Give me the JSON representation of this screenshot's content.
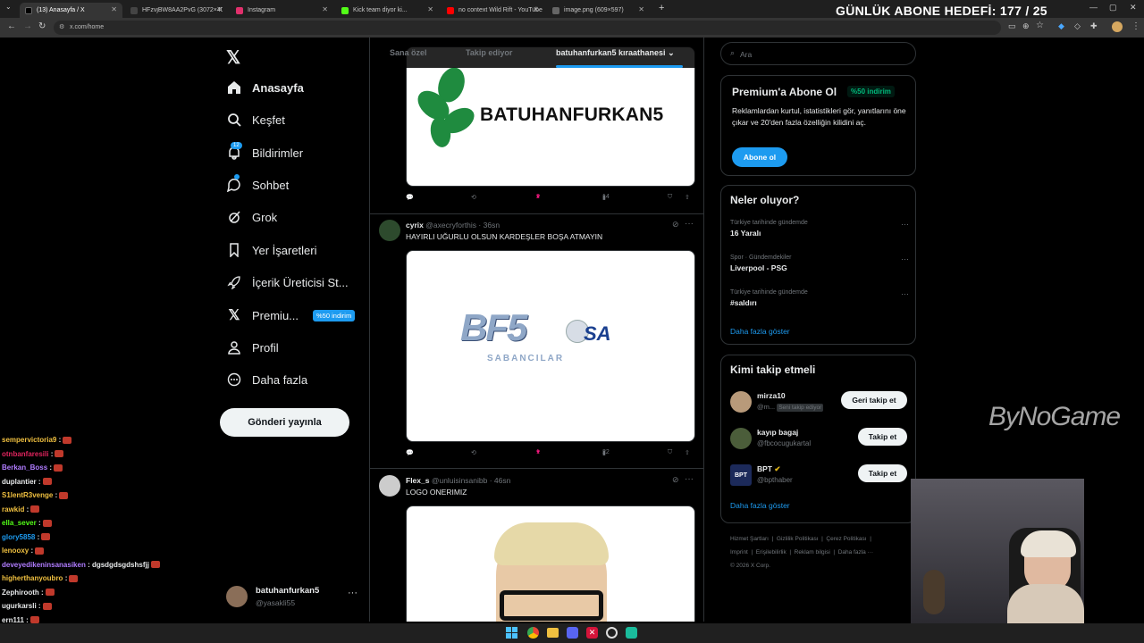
{
  "browser": {
    "tabs": [
      {
        "title": "(13) Anasayfa / X",
        "active": true,
        "fav_color": "#000000"
      },
      {
        "title": "HFzvjBW8AA2PvG (3072×4096)",
        "active": false,
        "fav_color": "#444444"
      },
      {
        "title": "Instagram",
        "active": false,
        "fav_color": "#e1306c"
      },
      {
        "title": "Kick team diyor ki...",
        "active": false,
        "fav_color": "#53fc18"
      },
      {
        "title": "no context Wild Rift - YouTube",
        "active": false,
        "fav_color": "#ff0000"
      },
      {
        "title": "image.png (609×597)",
        "active": false,
        "fav_color": "#666666"
      }
    ],
    "url": "x.com/home"
  },
  "overlay": {
    "goal_text": "GÜNLÜK ABONE HEDEFİ: 177 / 25",
    "watermark": "ByNoGame"
  },
  "nav": {
    "items": [
      {
        "label": "Anasayfa",
        "icon": "home-icon"
      },
      {
        "label": "Keşfet",
        "icon": "search-icon"
      },
      {
        "label": "Bildirimler",
        "icon": "bell-icon",
        "badge": "12"
      },
      {
        "label": "Sohbet",
        "icon": "chat-icon"
      },
      {
        "label": "Grok",
        "icon": "grok-icon"
      },
      {
        "label": "Yer İşaretleri",
        "icon": "bookmark-icon"
      },
      {
        "label": "İçerik Üreticisi St...",
        "icon": "rocket-icon"
      },
      {
        "label": "Premiu...",
        "icon": "x-icon",
        "pill": "%50 indirim"
      },
      {
        "label": "Profil",
        "icon": "person-icon"
      },
      {
        "label": "Daha fazla",
        "icon": "more-circle-icon"
      }
    ],
    "post_button": "Gönderi yayınla",
    "account": {
      "name": "batuhanfurkan5",
      "handle": "@yasakli55"
    }
  },
  "feed": {
    "tabs": [
      "Sana özel",
      "Takip ediyor",
      "batuhanfurkan5 kıraathanesi"
    ],
    "post0": {
      "image_text": "BATUHANFURKAN5",
      "likes": "2",
      "views": "14"
    },
    "post1": {
      "name": "cyrix",
      "handle": "@axecryforthis",
      "time": "· 36sn",
      "text": "HAYIRLI UĞURLU OLSUN KARDEŞLER BOŞA ATMAYIN",
      "logo_main": "BF5",
      "logo_sa": "SA",
      "logo_sub": "SABANCILAR",
      "likes": "1",
      "views": "22"
    },
    "post2": {
      "name": "Flex_s",
      "handle": "@unluisinsanibb",
      "time": "· 46sn",
      "text": "LOGO ONERIMIZ"
    }
  },
  "right": {
    "search_placeholder": "Ara",
    "premium": {
      "title": "Premium'a Abone Ol",
      "pill": "%50 indirim",
      "desc": "Reklamlardan kurtul, istatistikleri gör, yanıtlarını öne çıkar ve 20'den fazla özelliğin kilidini aç.",
      "button": "Abone ol"
    },
    "trends": {
      "title": "Neler oluyor?",
      "items": [
        {
          "context": "Türkiye tarihinde gündemde",
          "name": "16 Yaralı"
        },
        {
          "context": "Spor · Gündemdekiler",
          "name": "Liverpool - PSG"
        },
        {
          "context": "Türkiye tarihinde gündemde",
          "name": "#saldırı"
        }
      ],
      "more": "Daha fazla göster"
    },
    "follow": {
      "title": "Kimi takip etmeli",
      "items": [
        {
          "name": "mirza10",
          "handle": "@m...",
          "tag": "Seni takip ediyor",
          "button": "Geri takip et"
        },
        {
          "name": "kayıp bagaj",
          "handle": "@fbcocugukartal",
          "tag": "",
          "button": "Takip et"
        },
        {
          "name": "BPT",
          "handle": "@bpthaber",
          "tag": "",
          "button": "Takip et"
        }
      ],
      "more": "Daha fazla göster"
    },
    "footer": {
      "line1": [
        "Hizmet Şartları",
        "Gizlilik Politikası",
        "Çerez Politikası"
      ],
      "line2": [
        "Imprint",
        "Erişilebilirlik",
        "Reklam bilgisi",
        "Daha fazla ···"
      ],
      "copyright": "© 2026 X Corp."
    }
  },
  "chat": [
    {
      "user": "sempervictoria9",
      "msg": ":",
      "color": "#f0c040"
    },
    {
      "user": "otnbanfaresili",
      "msg": ":",
      "color": "#e0245e"
    },
    {
      "user": "Berkan_Boss",
      "msg": ":",
      "color": "#b07cff"
    },
    {
      "user": "duplantier",
      "msg": ":",
      "color": "#e7e9ea"
    },
    {
      "user": "S1lentR3venge",
      "msg": ":",
      "color": "#f0c040"
    },
    {
      "user": "rawkid",
      "msg": ":",
      "color": "#f0c040"
    },
    {
      "user": "ella_sever",
      "msg": ":",
      "color": "#53fc18"
    },
    {
      "user": "glory5858",
      "msg": ":",
      "color": "#1d9bf0"
    },
    {
      "user": "lenooxy",
      "msg": ":",
      "color": "#f0c040"
    },
    {
      "user": "deveyedikeninsanasiken",
      "msg": ": dgsdgdsgdshsfjj",
      "color": "#b07cff"
    },
    {
      "user": "higherthanyoubro",
      "msg": ":",
      "color": "#f0c040"
    },
    {
      "user": "Zephirooth",
      "msg": ":",
      "color": "#e7e9ea"
    },
    {
      "user": "ugurkarsli",
      "msg": ":",
      "color": "#e7e9ea"
    },
    {
      "user": "ern111",
      "msg": ":",
      "color": "#e7e9ea"
    }
  ]
}
